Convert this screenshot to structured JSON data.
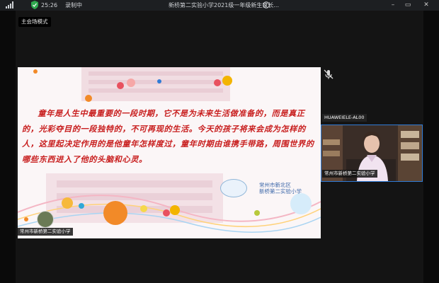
{
  "status_bar": {
    "time": "25:26",
    "recording": "录制中",
    "meeting_title": "新桥第二实验小学2021级一年级新生家长...",
    "info_icon": "info-icon"
  },
  "window_controls": {
    "minimize": "–",
    "restore": "▭",
    "close": "✕"
  },
  "view_mode": {
    "label": "主会场模式"
  },
  "shared_slide": {
    "text": "童年是人生中最重要的一段时期，它不是为未来生活做准备的，而是真正的，光彩夺目的一段独特的，不可再现的生活。今天的孩子将来会成为怎样的人，这里起决定作用的是他童年怎样度过，童年时期由谁携手带路，周围世界的哪些东西进入了他的头脑和心灵。",
    "school_name_line1": "常州市新北区",
    "school_name_line2": "新桥第二实验小学"
  },
  "main_speaker": {
    "name": "常州市新桥第二实验小学"
  },
  "side_panel": {
    "muted_participant": {
      "name": "HUAWEIELE-AL00"
    },
    "video_participant": {
      "name": "常州市新桥第二实验小学"
    }
  },
  "colors": {
    "accent": "#2f7bd6",
    "slide_text": "#c81e1e"
  }
}
